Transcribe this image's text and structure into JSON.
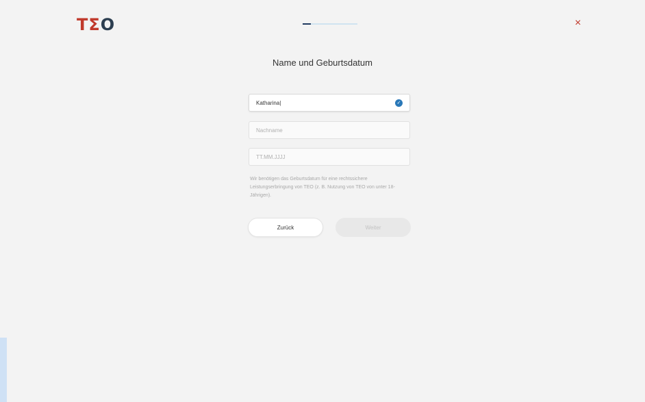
{
  "brand": {
    "logo_letters": [
      "T",
      "Σ",
      "O"
    ]
  },
  "progress": {
    "value": 0.15
  },
  "header": {
    "close_glyph": "×"
  },
  "form": {
    "title": "Name und Geburtsdatum",
    "first_name": {
      "value": "Katharina|"
    },
    "last_name": {
      "placeholder": "Nachname"
    },
    "birthdate": {
      "placeholder": "TT.MM.JJJJ"
    },
    "info_text": "Wir benötigen das Geburtsdatum für eine rechtssichere Leistungserbringung von TEO (z. B. Nutzung von TEO von unter 18-Jährigen).",
    "back_label": "Zurück",
    "next_label": "Weiter"
  },
  "icons": {
    "close": "close-icon",
    "valid": "check-circle-icon"
  },
  "colors": {
    "brand_red": "#c0392b",
    "brand_dark": "#2c3e50",
    "accent_blue": "#2a78b8"
  }
}
